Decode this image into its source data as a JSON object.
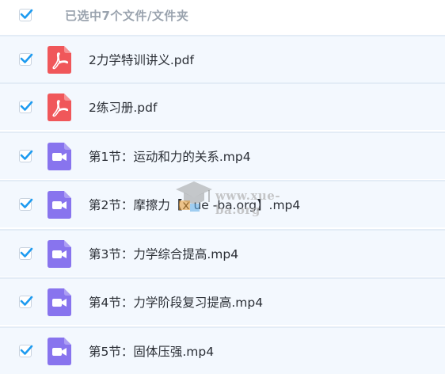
{
  "header": {
    "selection_label": "已选中7个文件/文件夹",
    "checked": true
  },
  "files": [
    {
      "name": "2力学特训讲义.pdf",
      "type": "pdf",
      "checked": true
    },
    {
      "name": "2练习册.pdf",
      "type": "pdf",
      "checked": true
    },
    {
      "name": "第1节：运动和力的关系.mp4",
      "type": "video",
      "checked": true
    },
    {
      "name": "第2节：摩擦力【x ue -ba.org】.mp4",
      "type": "video",
      "checked": true
    },
    {
      "name": "第3节：力学综合提高.mp4",
      "type": "video",
      "checked": true
    },
    {
      "name": "第4节：力学阶段复习提高.mp4",
      "type": "video",
      "checked": true
    },
    {
      "name": "第5节：固体压强.mp4",
      "type": "video",
      "checked": true
    }
  ],
  "watermark": {
    "text": "www.xue-ba.org"
  },
  "colors": {
    "check": "#1e9bf0",
    "pdf_icon": "#f0575a",
    "video_icon": "#8874ee",
    "row_bg": "#f3f8fe"
  },
  "icons": {
    "pdf": "pdf-file-icon",
    "video": "video-file-icon",
    "check": "checkmark-icon",
    "watermark": "graduation-cap-icon"
  }
}
